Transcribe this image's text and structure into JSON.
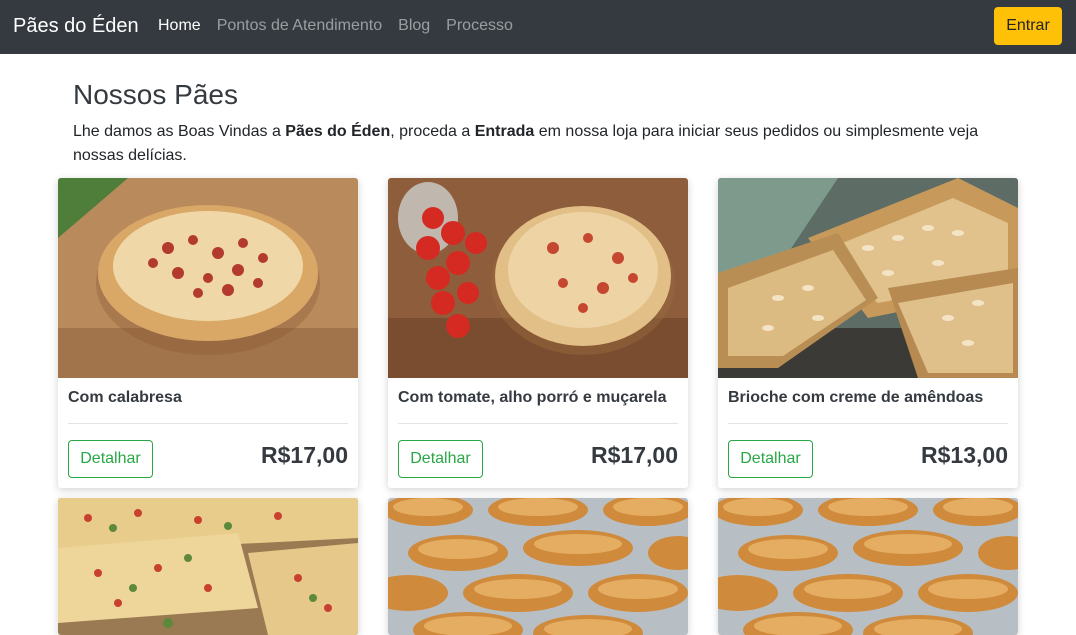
{
  "navbar": {
    "brand": "Pães do Éden",
    "links": [
      {
        "label": "Home",
        "active": true
      },
      {
        "label": "Pontos de Atendimento",
        "active": false
      },
      {
        "label": "Blog",
        "active": false
      },
      {
        "label": "Processo",
        "active": false
      }
    ],
    "login_label": "Entrar"
  },
  "main": {
    "title": "Nossos Pães",
    "intro": {
      "part1": "Lhe damos as Boas Vindas a ",
      "brand": "Pães do Éden",
      "part2": ", proceda a ",
      "entry": "Entrada",
      "part3": " em nossa loja para iniciar seus pedidos ou simplesmente veja nossas delícias."
    }
  },
  "products": [
    {
      "name": "Com calabresa",
      "price": "R$17,00",
      "detail_label": "Detalhar",
      "image": "calabresa-bread-photo"
    },
    {
      "name": "Com tomate, alho porró e muçarela",
      "price": "R$17,00",
      "detail_label": "Detalhar",
      "image": "tomato-bread-photo"
    },
    {
      "name": "Brioche com creme de amêndoas",
      "price": "R$13,00",
      "detail_label": "Detalhar",
      "image": "almond-brioche-photo"
    },
    {
      "image": "focaccia-photo"
    },
    {
      "image": "empanadas-photo"
    },
    {
      "image": "empanadas-photo"
    }
  ],
  "colors": {
    "navbar": "#343a40",
    "login_button": "#ffc107",
    "detail_button": "#28a745"
  }
}
